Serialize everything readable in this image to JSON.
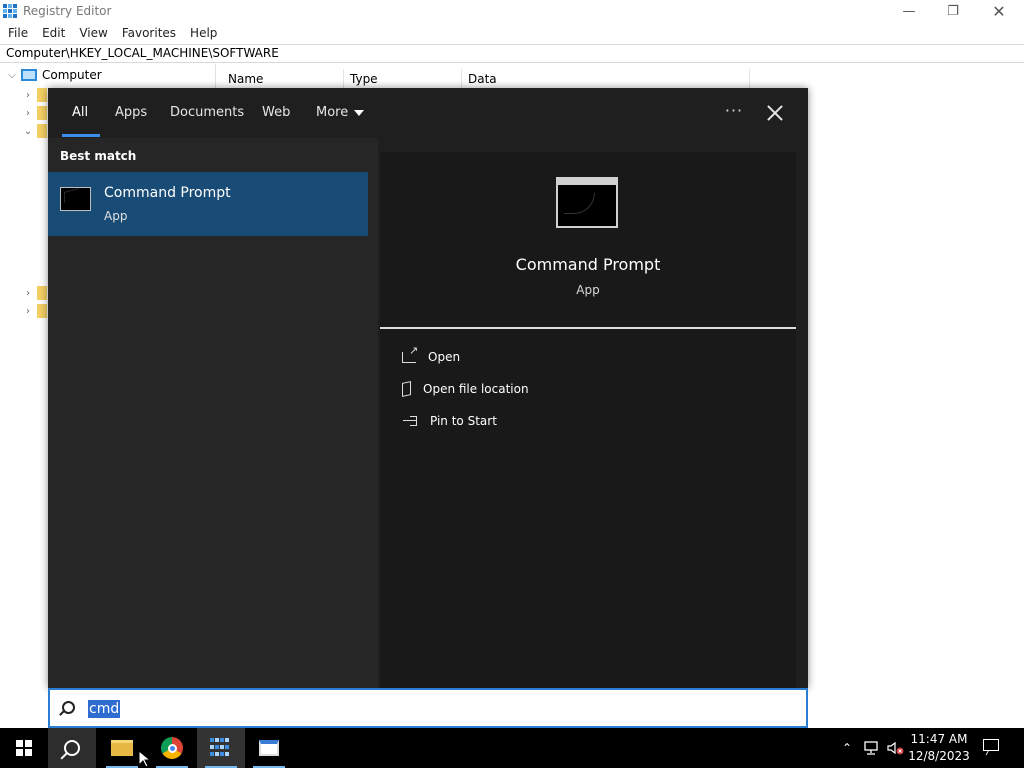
{
  "registry": {
    "title": "Registry Editor",
    "menu": [
      "File",
      "Edit",
      "View",
      "Favorites",
      "Help"
    ],
    "address": "Computer\\HKEY_LOCAL_MACHINE\\SOFTWARE",
    "tree_root": "Computer",
    "columns": [
      "Name",
      "Type",
      "Data"
    ]
  },
  "search": {
    "tabs": [
      "All",
      "Apps",
      "Documents",
      "Web",
      "More"
    ],
    "active_tab": "All",
    "section_title": "Best match",
    "result": {
      "name": "Command Prompt",
      "kind": "App"
    },
    "detail": {
      "name": "Command Prompt",
      "kind": "App"
    },
    "actions": [
      {
        "label": "Open",
        "icon": "open-icon"
      },
      {
        "label": "Open file location",
        "icon": "file-location-icon"
      },
      {
        "label": "Pin to Start",
        "icon": "pin-icon"
      }
    ],
    "query": "cmd"
  },
  "taskbar": {
    "time": "11:47 AM",
    "date": "12/8/2023",
    "apps": [
      "start",
      "search",
      "file-explorer",
      "chrome",
      "registry-editor",
      "notepad"
    ]
  }
}
